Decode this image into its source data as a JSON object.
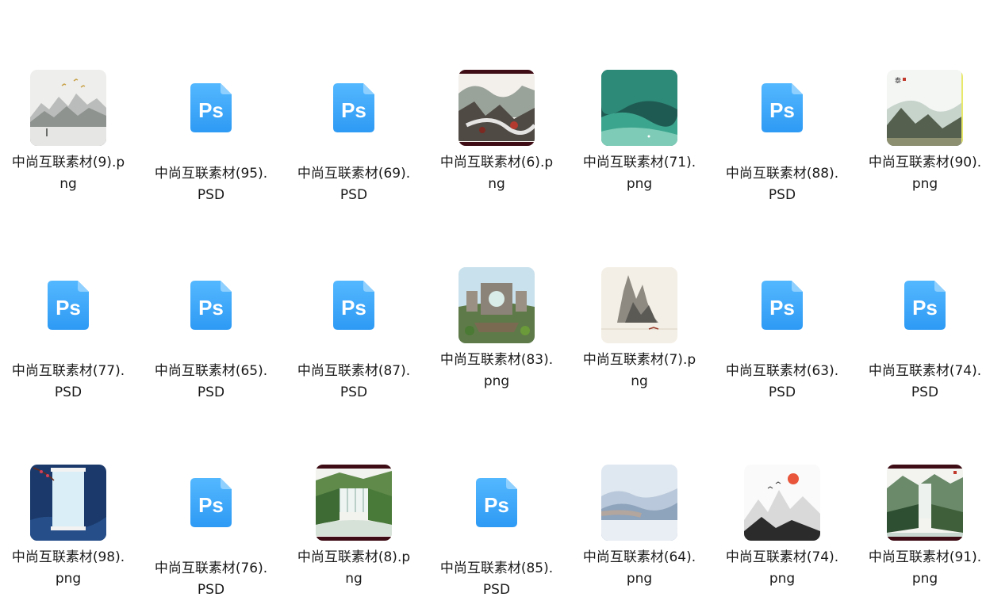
{
  "files": [
    {
      "name": "中尚互联素材(9).png",
      "type": "image",
      "art": "mist-mountains"
    },
    {
      "name": "中尚互联素材(95).PSD",
      "type": "psd"
    },
    {
      "name": "中尚互联素材(69).PSD",
      "type": "psd"
    },
    {
      "name": "中尚互联素材(6).png",
      "type": "image",
      "art": "river-rocks"
    },
    {
      "name": "中尚互联素材(71).png",
      "type": "image",
      "art": "green-sea"
    },
    {
      "name": "中尚互联素材(88).PSD",
      "type": "psd"
    },
    {
      "name": "中尚互联素材(90).png",
      "type": "image",
      "art": "mountain-ink"
    },
    {
      "name": "中尚互联素材(77).PSD",
      "type": "psd"
    },
    {
      "name": "中尚互联素材(65).PSD",
      "type": "psd"
    },
    {
      "name": "中尚互联素材(87).PSD",
      "type": "psd"
    },
    {
      "name": "中尚互联素材(83).png",
      "type": "image",
      "art": "garden-gate"
    },
    {
      "name": "中尚互联素材(7).png",
      "type": "image",
      "art": "ink-peaks"
    },
    {
      "name": "中尚互联素材(63).PSD",
      "type": "psd"
    },
    {
      "name": "中尚互联素材(74).PSD",
      "type": "psd"
    },
    {
      "name": "中尚互联素材(98).png",
      "type": "image",
      "art": "blue-scroll"
    },
    {
      "name": "中尚互联素材(76).PSD",
      "type": "psd"
    },
    {
      "name": "中尚互联素材(8).png",
      "type": "image",
      "art": "waterfall-green"
    },
    {
      "name": "中尚互联素材(85).PSD",
      "type": "psd"
    },
    {
      "name": "中尚互联素材(64).png",
      "type": "image",
      "art": "blue-mist"
    },
    {
      "name": "中尚互联素材(74).png",
      "type": "image",
      "art": "sun-ink"
    },
    {
      "name": "中尚互联素材(91).png",
      "type": "image",
      "art": "waterfall-scroll"
    }
  ],
  "icons": {
    "psd": "photoshop-file-icon",
    "image": "image-thumbnail"
  },
  "colors": {
    "ps_light": "#51b6ff",
    "ps_dark": "#2f9bf5",
    "ps_fold": "#9dd4ff"
  }
}
